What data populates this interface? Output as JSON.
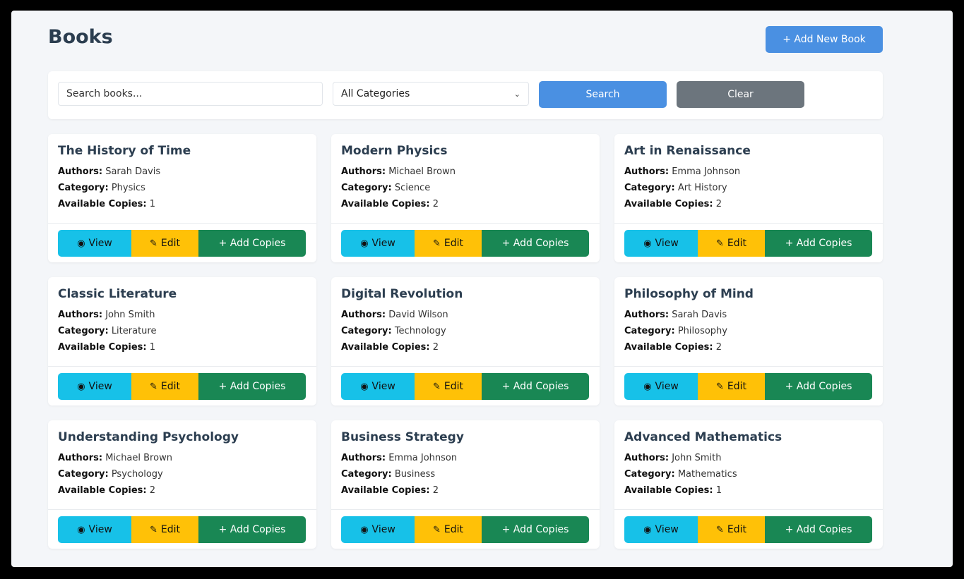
{
  "page": {
    "title": "Books",
    "add_button": "+ Add New Book"
  },
  "search": {
    "placeholder": "Search books...",
    "category_selected": "All Categories",
    "search_button": "Search",
    "clear_button": "Clear"
  },
  "labels": {
    "authors": "Authors:",
    "category": "Category:",
    "copies": "Available Copies:",
    "view": "View",
    "edit": "Edit",
    "add_copies": "+ Add Copies"
  },
  "icons": {
    "view": "eye-icon",
    "edit": "edit-icon"
  },
  "colors": {
    "primary": "#4a90e2",
    "secondary": "#6c757d",
    "info": "#17c1e8",
    "warning": "#ffc107",
    "success": "#198754"
  },
  "books": [
    {
      "title": "The History of Time",
      "authors": "Sarah Davis",
      "category": "Physics",
      "copies": "1"
    },
    {
      "title": "Modern Physics",
      "authors": "Michael Brown",
      "category": "Science",
      "copies": "2"
    },
    {
      "title": "Art in Renaissance",
      "authors": "Emma Johnson",
      "category": "Art History",
      "copies": "2"
    },
    {
      "title": "Classic Literature",
      "authors": "John Smith",
      "category": "Literature",
      "copies": "1"
    },
    {
      "title": "Digital Revolution",
      "authors": "David Wilson",
      "category": "Technology",
      "copies": "2"
    },
    {
      "title": "Philosophy of Mind",
      "authors": "Sarah Davis",
      "category": "Philosophy",
      "copies": "2"
    },
    {
      "title": "Understanding Psychology",
      "authors": "Michael Brown",
      "category": "Psychology",
      "copies": "2"
    },
    {
      "title": "Business Strategy",
      "authors": "Emma Johnson",
      "category": "Business",
      "copies": "2"
    },
    {
      "title": "Advanced Mathematics",
      "authors": "John Smith",
      "category": "Mathematics",
      "copies": "1"
    }
  ]
}
